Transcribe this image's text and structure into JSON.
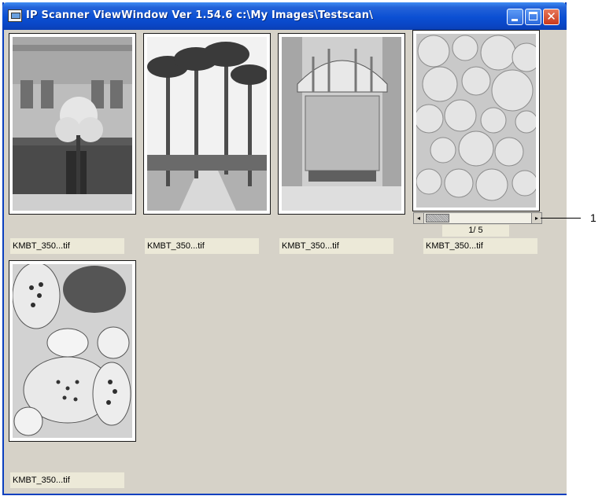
{
  "window": {
    "title": "IP Scanner ViewWindow Ver 1.54.6 c:\\My Images\\Testscan\\",
    "controls": {
      "minimize_icon": "minimize-icon",
      "maximize_icon": "maximize-icon",
      "close_icon": "close-icon"
    }
  },
  "thumbnails": [
    {
      "caption": "KMBT_350...tif",
      "subject": "storefront building with tree"
    },
    {
      "caption": "KMBT_350...tif",
      "subject": "palm trees along street"
    },
    {
      "caption": "KMBT_350...tif",
      "subject": "building entrance with awning"
    },
    {
      "caption": "KMBT_350...tif",
      "subject": "fruit pile"
    },
    {
      "caption": "KMBT_350...tif",
      "subject": "sliced fruits still life"
    }
  ],
  "multipage": {
    "page_indicator": "1/ 5",
    "left_arrow": "◂",
    "right_arrow": "▸"
  },
  "callout": {
    "label": "1"
  },
  "colors": {
    "title_bar": "#0b4fd3",
    "client_bg": "#d6d2c8",
    "caption_bg": "#ece9d8"
  }
}
